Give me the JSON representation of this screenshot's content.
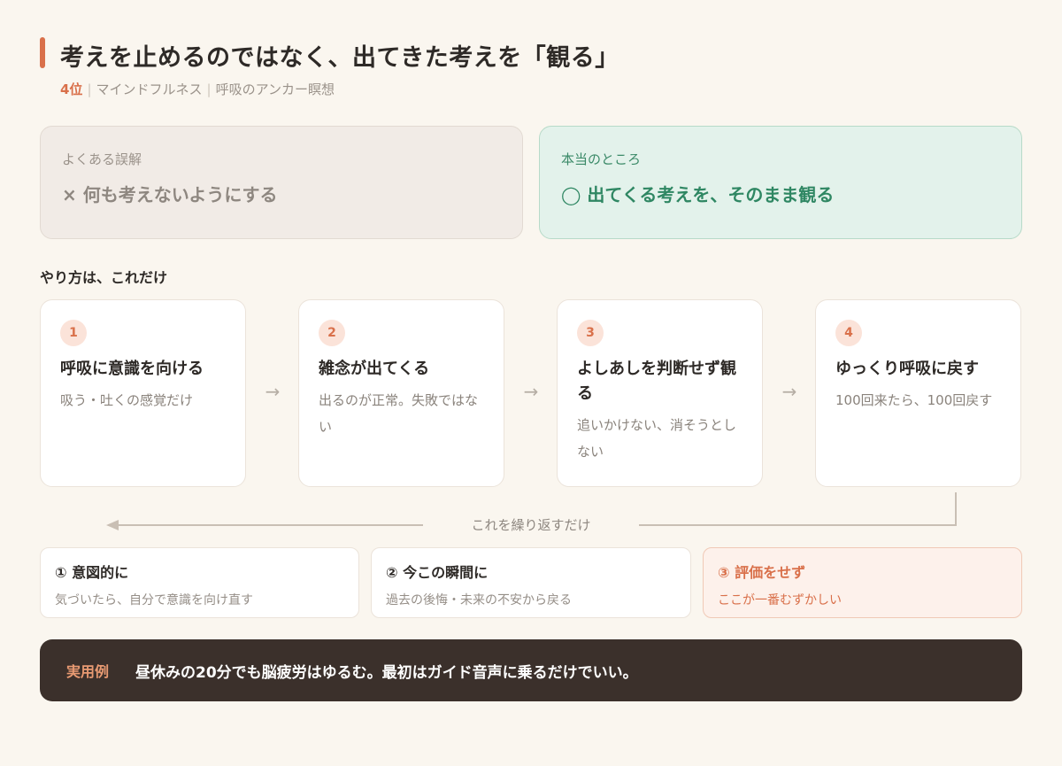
{
  "header": {
    "title": "考えを止めるのではなく、出てきた考えを「観る」",
    "rank": "4位",
    "category": "マインドフルネス",
    "method": "呼吸のアンカー瞑想"
  },
  "myth": {
    "label": "よくある誤解",
    "text": "× 何も考えないようにする"
  },
  "truth": {
    "label": "本当のところ",
    "text": "◯ 出てくる考えを、そのまま観る"
  },
  "steps_heading": "やり方は、これだけ",
  "steps": [
    {
      "num": "1",
      "title": "呼吸に意識を向ける",
      "desc": "吸う・吐くの感覚だけ"
    },
    {
      "num": "2",
      "title": "雑念が出てくる",
      "desc": "出るのが正常。失敗ではない"
    },
    {
      "num": "3",
      "title": "よしあしを判断せず観る",
      "desc": "追いかけない、消そうとしない"
    },
    {
      "num": "4",
      "title": "ゆっくり呼吸に戻す",
      "desc": "100回来たら、100回戻す"
    }
  ],
  "arrow_glyph": "→",
  "loop_label": "これを繰り返すだけ",
  "points": [
    {
      "title": "① 意図的に",
      "desc": "気づいたら、自分で意識を向け直す"
    },
    {
      "title": "② 今この瞬間に",
      "desc": "過去の後悔・未来の不安から戻る"
    },
    {
      "title": "③ 評価をせず",
      "desc": "ここが一番むずかしい"
    }
  ],
  "banner": {
    "tag": "実用例",
    "text": "昼休みの20分でも脳疲労はゆるむ。最初はガイド音声に乗るだけでいい。"
  },
  "colors": {
    "accent": "#d9704a",
    "truth_green": "#2f8763",
    "banner_bg": "#3b302b",
    "page_bg": "#faf6ef"
  }
}
